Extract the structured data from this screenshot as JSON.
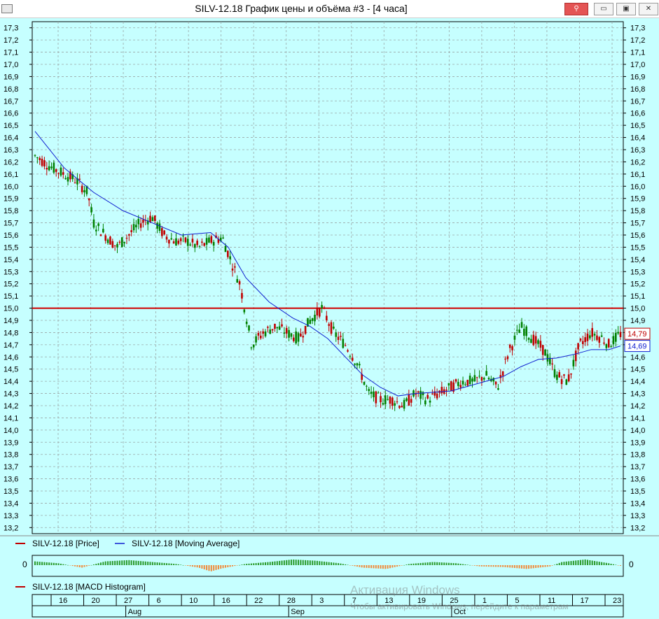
{
  "window": {
    "title": "SILV-12.18 График цены и объёма #3 - [4 часа]",
    "buttons": {
      "pin": "⚲",
      "minimize": "▭",
      "maximize": "▣",
      "close": "✕"
    }
  },
  "colors": {
    "background": "#c6ffff",
    "grid": "#9aa8a8",
    "up_candle": "#008000",
    "down_candle": "#c00000",
    "moving_average": "#1020d0",
    "level_line": "#d00000",
    "macd_pos": "#2a9a2a",
    "macd_neg": "#f08a3a"
  },
  "legend": {
    "price": "SILV-12.18 [Price]",
    "ma": "SILV-12.18 [Moving Average]",
    "macd": "SILV-12.18 [MACD Histogram]"
  },
  "price_axis": {
    "labels": [
      "17,3",
      "17,2",
      "17,1",
      "17,0",
      "16,9",
      "16,8",
      "16,7",
      "16,6",
      "16,5",
      "16,4",
      "16,3",
      "16,2",
      "16,1",
      "16,0",
      "15,9",
      "15,8",
      "15,7",
      "15,6",
      "15,5",
      "15,4",
      "15,3",
      "15,2",
      "15,1",
      "15,0",
      "14,9",
      "14,8",
      "14,7",
      "14,6",
      "14,5",
      "14,4",
      "14,3",
      "14,2",
      "14,1",
      "14,0",
      "13,9",
      "13,8",
      "13,7",
      "13,6",
      "13,5",
      "13,4",
      "13,3",
      "13,2"
    ],
    "last_price_label": "14,79",
    "ma_label": "14,69"
  },
  "macd_axis": {
    "zero_label_left": "0",
    "zero_label_right": "0"
  },
  "time_axis": {
    "days": [
      "16",
      "20",
      "27",
      "6",
      "10",
      "16",
      "22",
      "28",
      "3",
      "7",
      "13",
      "19",
      "25",
      "1",
      "5",
      "11",
      "17",
      "23"
    ],
    "months": [
      "Aug",
      "Sep",
      "Oct"
    ]
  },
  "watermark": {
    "line1": "Активация Windows",
    "line2": "Чтобы активировать Windows, перейдите к параметрам"
  },
  "chart_data": {
    "type": "candlestick",
    "ylim": [
      13.15,
      17.35
    ],
    "level_line": 15.0,
    "x_range": [
      0,
      100
    ],
    "price_path": [
      [
        0,
        16.25
      ],
      [
        3,
        16.15
      ],
      [
        5,
        16.1
      ],
      [
        7,
        16.05
      ],
      [
        9,
        15.95
      ],
      [
        10,
        15.7
      ],
      [
        12,
        15.6
      ],
      [
        14,
        15.5
      ],
      [
        16,
        15.6
      ],
      [
        18,
        15.7
      ],
      [
        20,
        15.75
      ],
      [
        22,
        15.6
      ],
      [
        24,
        15.55
      ],
      [
        26,
        15.55
      ],
      [
        28,
        15.5
      ],
      [
        30,
        15.55
      ],
      [
        32,
        15.58
      ],
      [
        33,
        15.45
      ],
      [
        35,
        15.2
      ],
      [
        37,
        14.7
      ],
      [
        39,
        14.8
      ],
      [
        41,
        14.85
      ],
      [
        43,
        14.8
      ],
      [
        45,
        14.75
      ],
      [
        47,
        14.9
      ],
      [
        49,
        15.0
      ],
      [
        51,
        14.8
      ],
      [
        53,
        14.7
      ],
      [
        55,
        14.55
      ],
      [
        57,
        14.3
      ],
      [
        59,
        14.25
      ],
      [
        61,
        14.25
      ],
      [
        63,
        14.2
      ],
      [
        65,
        14.3
      ],
      [
        67,
        14.25
      ],
      [
        69,
        14.3
      ],
      [
        71,
        14.35
      ],
      [
        73,
        14.4
      ],
      [
        75,
        14.4
      ],
      [
        77,
        14.45
      ],
      [
        79,
        14.35
      ],
      [
        81,
        14.65
      ],
      [
        83,
        14.85
      ],
      [
        85,
        14.75
      ],
      [
        87,
        14.65
      ],
      [
        89,
        14.45
      ],
      [
        91,
        14.4
      ],
      [
        93,
        14.7
      ],
      [
        95,
        14.8
      ],
      [
        97,
        14.75
      ],
      [
        98,
        14.7
      ],
      [
        100,
        14.79
      ]
    ],
    "moving_average": [
      [
        0,
        16.45
      ],
      [
        5,
        16.15
      ],
      [
        10,
        15.95
      ],
      [
        15,
        15.8
      ],
      [
        20,
        15.7
      ],
      [
        25,
        15.6
      ],
      [
        30,
        15.62
      ],
      [
        33,
        15.5
      ],
      [
        36,
        15.25
      ],
      [
        40,
        15.05
      ],
      [
        44,
        14.92
      ],
      [
        47,
        14.85
      ],
      [
        50,
        14.75
      ],
      [
        53,
        14.6
      ],
      [
        56,
        14.45
      ],
      [
        59,
        14.35
      ],
      [
        62,
        14.28
      ],
      [
        65,
        14.3
      ],
      [
        68,
        14.31
      ],
      [
        71,
        14.32
      ],
      [
        74,
        14.36
      ],
      [
        77,
        14.4
      ],
      [
        80,
        14.44
      ],
      [
        83,
        14.52
      ],
      [
        86,
        14.58
      ],
      [
        89,
        14.59
      ],
      [
        92,
        14.62
      ],
      [
        95,
        14.66
      ],
      [
        98,
        14.66
      ],
      [
        100,
        14.69
      ]
    ],
    "macd_histogram": [
      [
        0,
        0.6
      ],
      [
        4,
        0.3
      ],
      [
        8,
        -0.4
      ],
      [
        12,
        0.6
      ],
      [
        16,
        0.8
      ],
      [
        20,
        0.5
      ],
      [
        24,
        0.2
      ],
      [
        28,
        -0.4
      ],
      [
        30,
        -1.0
      ],
      [
        32,
        -0.5
      ],
      [
        36,
        0.2
      ],
      [
        40,
        0.5
      ],
      [
        44,
        0.9
      ],
      [
        48,
        0.7
      ],
      [
        52,
        0.3
      ],
      [
        56,
        -0.4
      ],
      [
        60,
        -0.6
      ],
      [
        64,
        0.2
      ],
      [
        68,
        0.5
      ],
      [
        72,
        0.3
      ],
      [
        76,
        -0.2
      ],
      [
        80,
        -0.3
      ],
      [
        84,
        -0.6
      ],
      [
        88,
        -0.2
      ],
      [
        90,
        0.5
      ],
      [
        94,
        0.9
      ],
      [
        98,
        0.3
      ],
      [
        100,
        -0.1
      ]
    ]
  }
}
